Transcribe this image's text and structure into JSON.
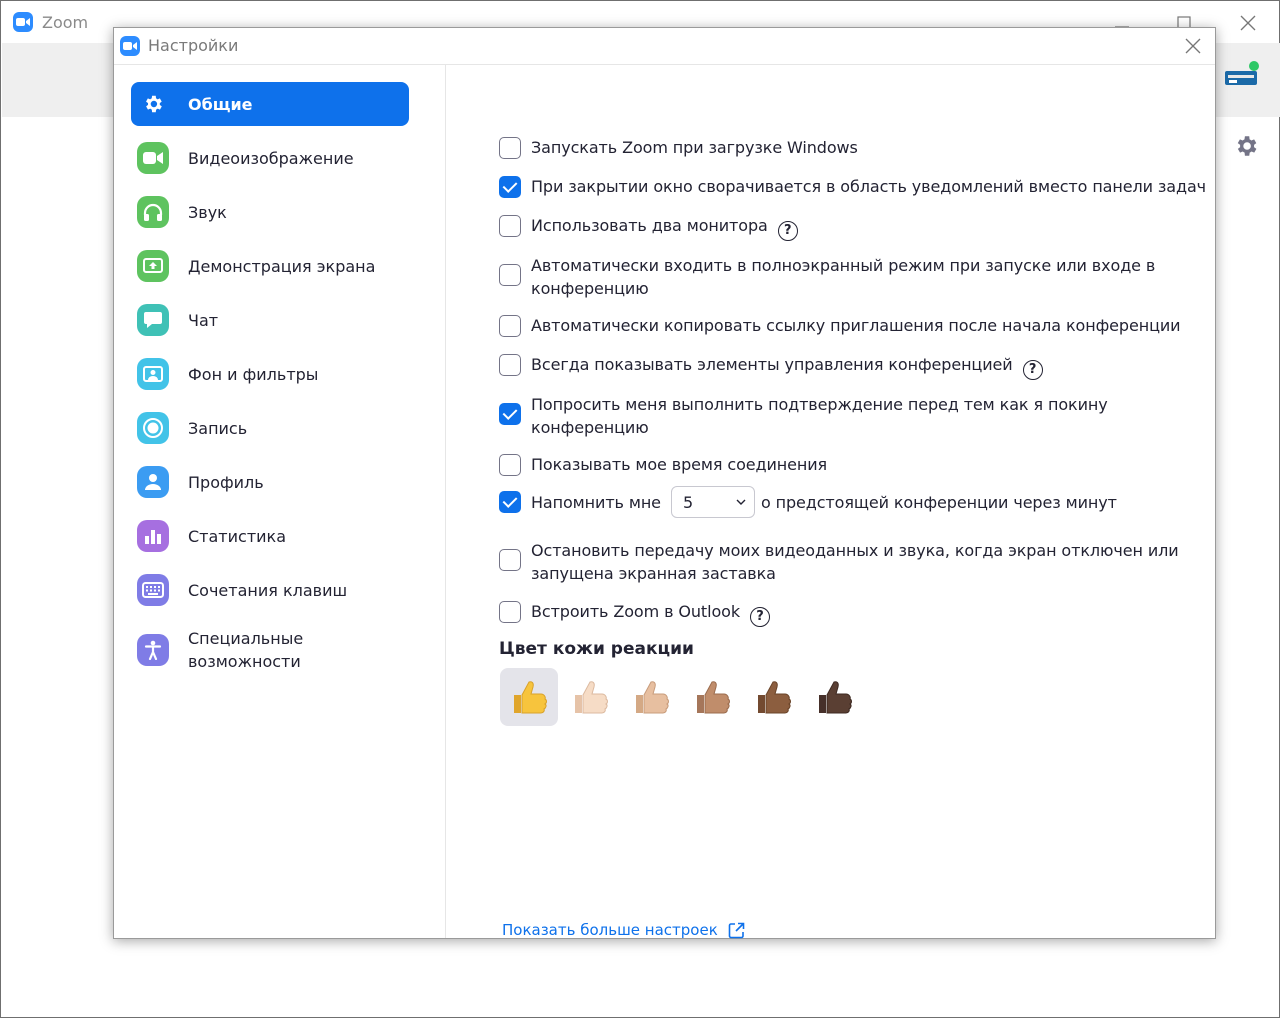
{
  "main_window": {
    "title": "Zoom"
  },
  "dialog": {
    "title": "Настройки"
  },
  "sidebar": {
    "items": [
      {
        "label": "Общие",
        "icon": "gear-icon",
        "active": true,
        "color": "#0e71eb"
      },
      {
        "label": "Видеоизображение",
        "icon": "video-camera-icon",
        "color": "#5ec35f"
      },
      {
        "label": "Звук",
        "icon": "headphones-icon",
        "color": "#5ec35f"
      },
      {
        "label": "Демонстрация экрана",
        "icon": "share-screen-icon",
        "color": "#5ec35f"
      },
      {
        "label": "Чат",
        "icon": "chat-bubble-icon",
        "color": "#3fc1b6"
      },
      {
        "label": "Фон и фильтры",
        "icon": "background-icon",
        "color": "#42c3e8"
      },
      {
        "label": "Запись",
        "icon": "record-icon",
        "color": "#42c3e8"
      },
      {
        "label": "Профиль",
        "icon": "profile-icon",
        "color": "#3b9cf2"
      },
      {
        "label": "Статистика",
        "icon": "statistics-icon",
        "color": "#a66fe0"
      },
      {
        "label": "Сочетания клавиш",
        "icon": "keyboard-icon",
        "color": "#7f7ce6"
      },
      {
        "label": "Специальные возможности",
        "icon": "accessibility-icon",
        "color": "#7f7ce6"
      }
    ]
  },
  "options": [
    {
      "label": "Запускать Zoom при загрузке Windows",
      "checked": false
    },
    {
      "label": "При закрытии окно сворачивается в область уведомлений вместо панели задач",
      "checked": true
    },
    {
      "label": "Использовать два монитора",
      "checked": false,
      "help": "?"
    },
    {
      "label": "Автоматически входить в полноэкранный режим при запуске или входе в конференцию",
      "checked": false
    },
    {
      "label": "Автоматически копировать ссылку приглашения после начала конференции",
      "checked": false
    },
    {
      "label": "Всегда показывать элементы управления конференцией",
      "checked": false,
      "help": "?"
    },
    {
      "label": "Попросить меня выполнить подтверждение перед тем как я покину конференцию",
      "checked": true
    },
    {
      "label": "Показывать мое время соединения",
      "checked": false
    },
    {
      "label_before": "Напомнить мне",
      "select_value": "5",
      "label_after": "о предстоящей конференции через минут",
      "checked": true
    },
    {
      "label": "Остановить передачу моих видеоданных и звука, когда экран отключен или запущена экранная заставка",
      "checked": false
    },
    {
      "label": "Встроить Zoom в Outlook",
      "checked": false,
      "help": "?"
    }
  ],
  "reaction_skin": {
    "title": "Цвет кожи реакции",
    "tones": [
      {
        "emoji": "👍",
        "color": "#f7c43d",
        "selected": true
      },
      {
        "emoji": "👍🏻",
        "color": "#f6dcc6"
      },
      {
        "emoji": "👍🏼",
        "color": "#e7bfa0"
      },
      {
        "emoji": "👍🏽",
        "color": "#c08d6b"
      },
      {
        "emoji": "👍🏾",
        "color": "#8c5e3f"
      },
      {
        "emoji": "👍🏿",
        "color": "#5a3f33"
      }
    ]
  },
  "more_settings_link": "Показать больше настроек",
  "colors": {
    "accent": "#0e71eb",
    "text": "#232333"
  }
}
